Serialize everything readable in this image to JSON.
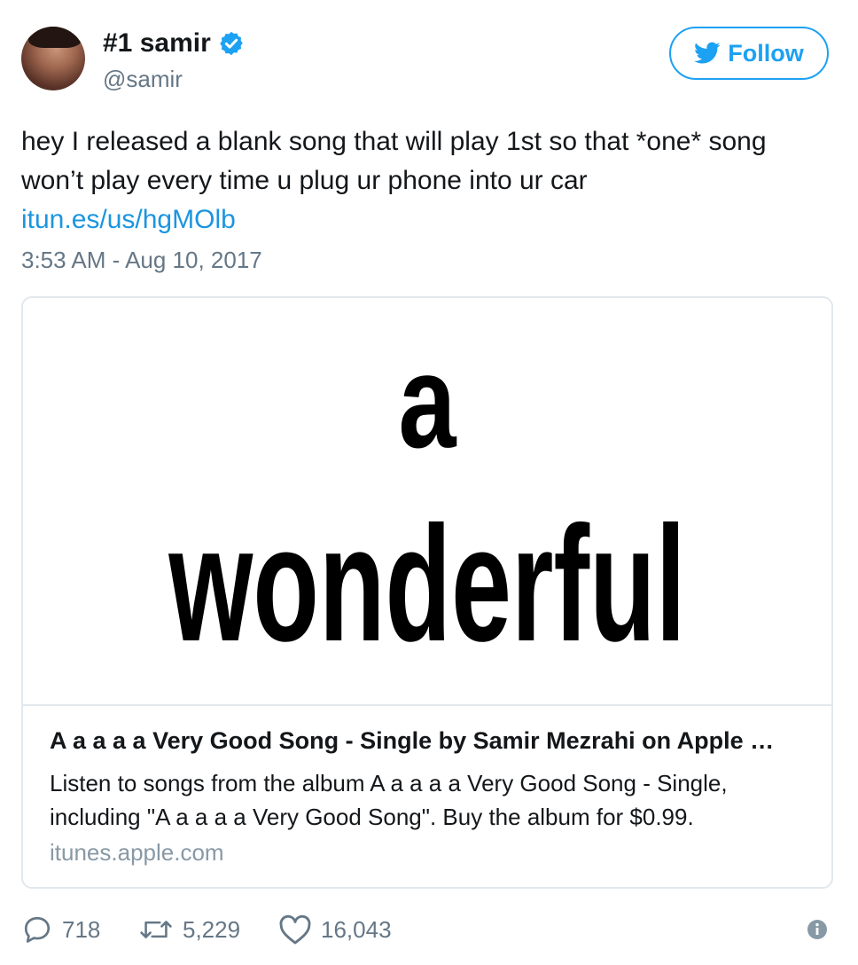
{
  "author": {
    "display_name": "#1 samir",
    "handle": "@samir",
    "avatar_icon": "avatar-photo",
    "verified_icon": "verified-badge-icon"
  },
  "follow_button": {
    "label": "Follow",
    "icon": "twitter-bird-icon",
    "color": "#1da1f2"
  },
  "tweet": {
    "text": "hey I released a blank song that will play 1st so that *one* song\nwon’t play every time u plug ur phone into ur car",
    "link": "itun.es/us/hgMOlb",
    "timestamp": "3:53 AM - Aug 10, 2017"
  },
  "card": {
    "image_text_line1": "a",
    "image_text_line2": "wonderful",
    "title": "A a a a a Very Good Song - Single by Samir Mezrahi on Apple …",
    "description": "Listen to songs from the album A a a a a Very Good Song - Single, including \"A a a a a Very Good Song\". Buy the album for $0.99.",
    "domain": "itunes.apple.com"
  },
  "actions": {
    "replies": "718",
    "retweets": "5,229",
    "likes": "16,043"
  },
  "colors": {
    "link": "#1b95e0",
    "muted": "#657786",
    "border": "#e1e8ed"
  }
}
